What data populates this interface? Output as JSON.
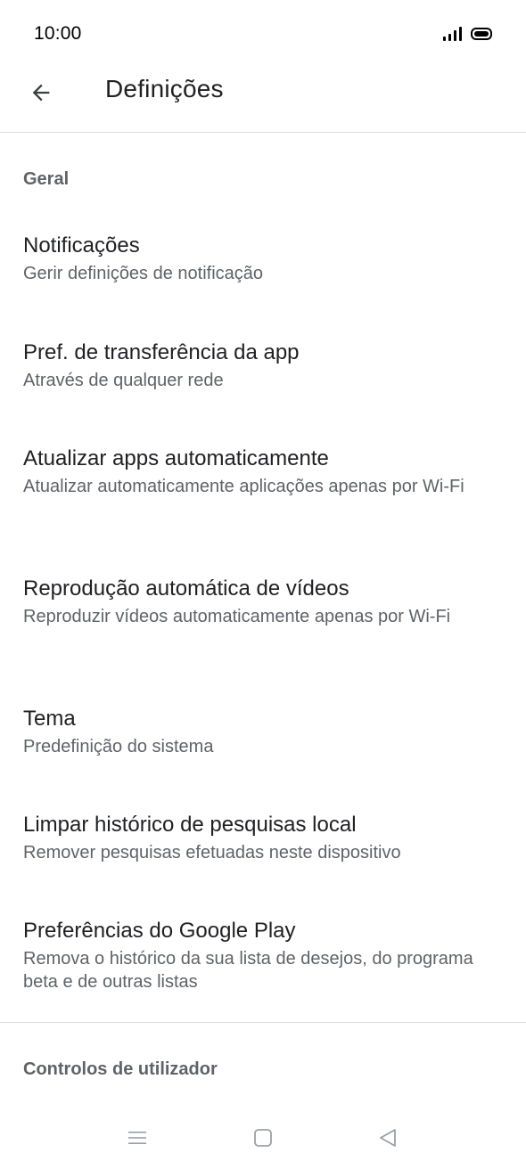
{
  "status_bar": {
    "time": "10:00"
  },
  "app_bar": {
    "title": "Definições",
    "back_icon": "arrow-left-icon"
  },
  "sections": [
    {
      "header": "Geral",
      "items": [
        {
          "title": "Notificações",
          "subtitle": "Gerir definições de notificação"
        },
        {
          "title": "Pref. de transferência da app",
          "subtitle": "Através de qualquer rede"
        },
        {
          "title": "Atualizar apps automaticamente",
          "subtitle": "Atualizar automaticamente aplicações apenas por Wi-Fi"
        },
        {
          "title": "Reprodução automática de vídeos",
          "subtitle": "Reproduzir vídeos automaticamente apenas por Wi-Fi"
        },
        {
          "title": "Tema",
          "subtitle": "Predefinição do sistema"
        },
        {
          "title": "Limpar histórico de pesquisas local",
          "subtitle": "Remover pesquisas efetuadas neste dispositivo"
        },
        {
          "title": "Preferências do Google Play",
          "subtitle": "Remova o histórico da sua lista de desejos, do programa beta e de outras listas"
        }
      ]
    },
    {
      "header": "Controlos de utilizador",
      "items": []
    }
  ],
  "nav_bar": {
    "icons": [
      "menu-icon",
      "home-square-icon",
      "back-triangle-icon"
    ]
  },
  "colors": {
    "primary_text": "#202124",
    "secondary_text": "#5f6368",
    "divider": "#dadce0",
    "background": "#ffffff"
  }
}
